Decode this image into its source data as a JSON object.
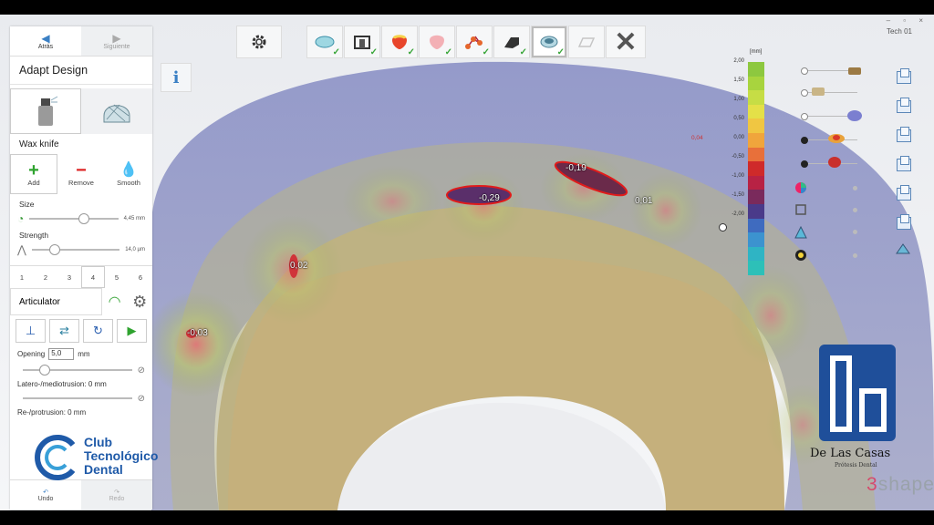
{
  "window": {
    "title": "Tech 01",
    "controls": "– ▫ ×"
  },
  "nav": {
    "back": "Atrás",
    "next": "Siguiente"
  },
  "panel": {
    "title": "Adapt Design",
    "tool_label": "Wax knife",
    "actions": [
      {
        "label": "Add",
        "icon": "plus-icon"
      },
      {
        "label": "Remove",
        "icon": "minus-icon"
      },
      {
        "label": "Smooth",
        "icon": "drop-icon"
      }
    ],
    "size_label": "Size",
    "size_value": "4,45 mm",
    "size_level": 0.55,
    "strength_label": "Strength",
    "strength_value": "14,0 µm",
    "strength_level": 0.2,
    "tabs": [
      "1",
      "2",
      "3",
      "4",
      "5",
      "6"
    ],
    "tab_selected": "4",
    "articulator_label": "Articulator",
    "opening_label": "Opening",
    "opening_value": "5,0",
    "opening_unit": "mm",
    "latero_label": "Latero-/mediotrusion: 0 mm",
    "retro_label": "Re-/protrusion: 0 mm",
    "undo": "Undo",
    "redo": "Redo"
  },
  "colorbar": {
    "unit": "[mm]",
    "ticks": [
      "2,00",
      "1,50",
      "1,00",
      "0,50",
      "0,00",
      "-0,50",
      "-1,00",
      "-1,50",
      "-2,00"
    ],
    "marker": "0,04",
    "colors": [
      "#8dc83f",
      "#a8d43e",
      "#c6dd45",
      "#e4e048",
      "#f0c642",
      "#f0a53c",
      "#e8703a",
      "#cf2a2a",
      "#b82244",
      "#7a2a5c",
      "#4a3a8a",
      "#3f6bbf",
      "#3c93cf",
      "#2fb4c4",
      "#2dc0b8"
    ]
  },
  "measurements": [
    {
      "text": "-0,19"
    },
    {
      "text": "-0,29"
    },
    {
      "text": "0,01"
    },
    {
      "text": "0,02"
    },
    {
      "text": "-0,03"
    }
  ],
  "logos": {
    "club_line1": "Club",
    "club_line2": "Tecnológico",
    "club_line3": "Dental",
    "dlc_name": "De Las Casas",
    "dlc_sub": "Prótesis Dental",
    "brand": "3shape"
  }
}
